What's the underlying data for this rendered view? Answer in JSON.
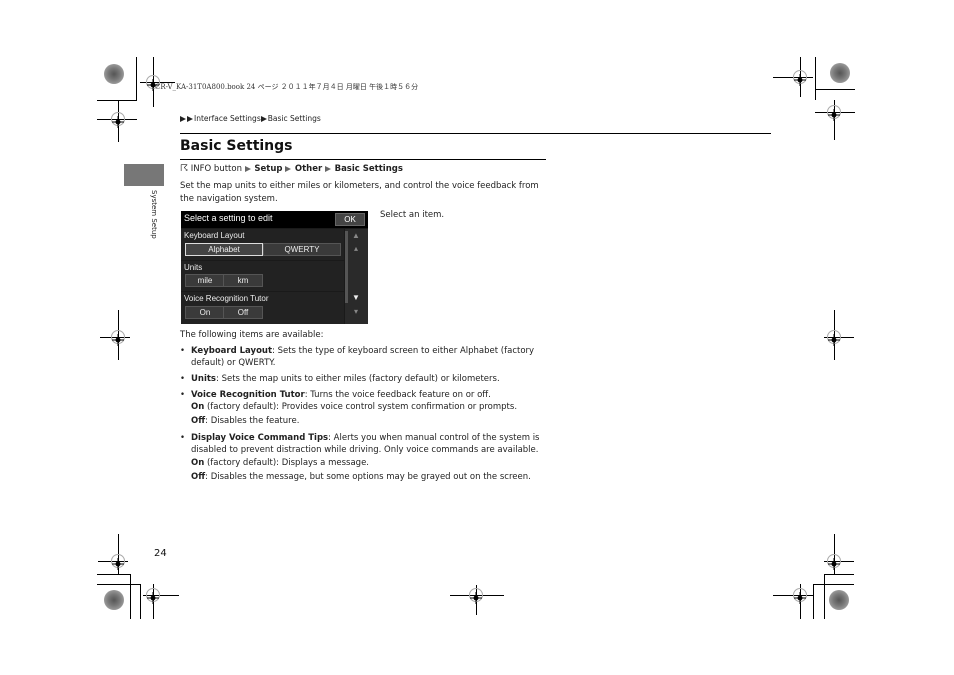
{
  "print_header": "CR-V_KA-31T0A800.book  24 ページ  ２０１１年７月４日  月曜日  午後１時５６分",
  "breadcrumb": {
    "items": [
      "Interface Settings",
      "Basic Settings"
    ]
  },
  "page_title": "Basic Settings",
  "side_tab_label": "System Setup",
  "nav_path": {
    "icon": "info-button-icon",
    "start": "INFO button",
    "steps": [
      "Setup",
      "Other",
      "Basic Settings"
    ]
  },
  "intro": "Set the map units to either miles or kilometers, and control the voice feedback from the navigation system.",
  "screen": {
    "title": "Select a setting to edit",
    "ok_label": "OK",
    "sections": [
      {
        "label": "Keyboard Layout",
        "options": [
          "Alphabet",
          "QWERTY"
        ],
        "selected": "Alphabet"
      },
      {
        "label": "Units",
        "options": [
          "mile",
          "km"
        ]
      },
      {
        "label": "Voice Recognition Tutor",
        "options": [
          "On",
          "Off"
        ]
      }
    ],
    "caption": "Select an item."
  },
  "items_intro": "The following items are available:",
  "items": [
    {
      "name": "Keyboard Layout",
      "desc": ": Sets the type of keyboard screen to either Alphabet (factory default) or QWERTY."
    },
    {
      "name": "Units",
      "desc": ": Sets the map units to either miles (factory default) or kilometers."
    },
    {
      "name": "Voice Recognition Tutor",
      "desc": ": Turns the voice feedback feature on or off.",
      "sub": [
        {
          "name": "On",
          "desc": " (factory default): Provides voice control system confirmation or prompts."
        },
        {
          "name": "Off",
          "desc": ": Disables the feature."
        }
      ]
    },
    {
      "name": "Display Voice Command Tips",
      "desc": ": Alerts you when manual control of the system is disabled to prevent distraction while driving. Only voice commands are available.",
      "sub": [
        {
          "name": "On",
          "desc": " (factory default): Displays a message."
        },
        {
          "name": "Off",
          "desc": ": Disables the message, but some options may be grayed out on the screen."
        }
      ]
    }
  ],
  "page_number": "24"
}
